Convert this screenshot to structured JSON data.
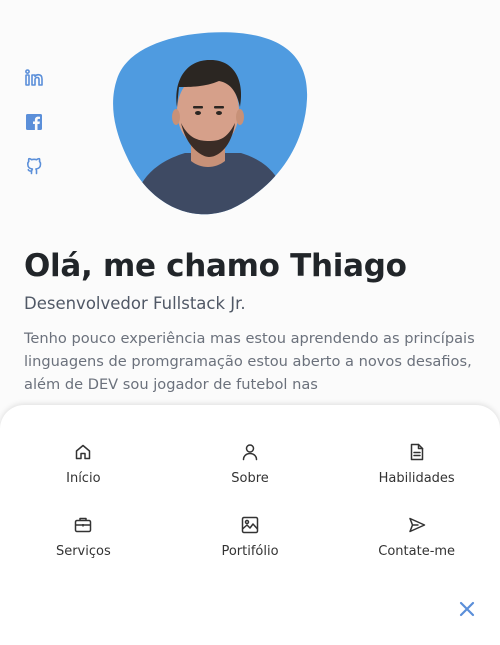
{
  "social": [
    {
      "name": "linkedin",
      "icon": "linkedin-icon"
    },
    {
      "name": "facebook",
      "icon": "facebook-icon"
    },
    {
      "name": "github",
      "icon": "github-icon"
    }
  ],
  "profile": {
    "photo_alt": "profile-photo",
    "background_color": "#4f9be0"
  },
  "hero": {
    "title": "Olá, me chamo Thiago",
    "subtitle": "Desenvolvedor Fullstack Jr.",
    "description": "Tenho pouco experiência mas estou aprendendo as princípais linguagens de promgramação estou aberto a novos desafios, além de DEV sou jogador de futebol nas"
  },
  "menu": {
    "items": [
      {
        "label": "Início",
        "icon": "home-icon"
      },
      {
        "label": "Sobre",
        "icon": "user-icon"
      },
      {
        "label": "Habilidades",
        "icon": "file-icon"
      },
      {
        "label": "Serviços",
        "icon": "briefcase-icon"
      },
      {
        "label": "Portifólio",
        "icon": "image-icon"
      },
      {
        "label": "Contate-me",
        "icon": "send-icon"
      }
    ],
    "close_icon": "close-icon"
  },
  "colors": {
    "accent": "#5b8fd9",
    "blob": "#4f9be0",
    "text": "#212529"
  }
}
